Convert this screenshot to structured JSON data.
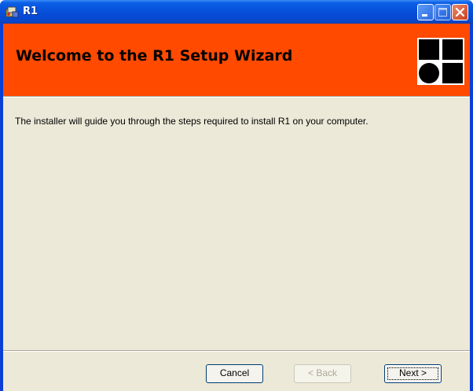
{
  "window": {
    "title": "R1"
  },
  "banner": {
    "title": "Welcome to the R1 Setup Wizard"
  },
  "content": {
    "description": "The installer will guide you through the steps required to install R1 on your computer."
  },
  "buttons": {
    "cancel": "Cancel",
    "back": "< Back",
    "next": "Next >"
  },
  "colors": {
    "banner": "#ff4a00",
    "titlebar": "#0853db",
    "dialog_bg": "#ece9d8"
  }
}
